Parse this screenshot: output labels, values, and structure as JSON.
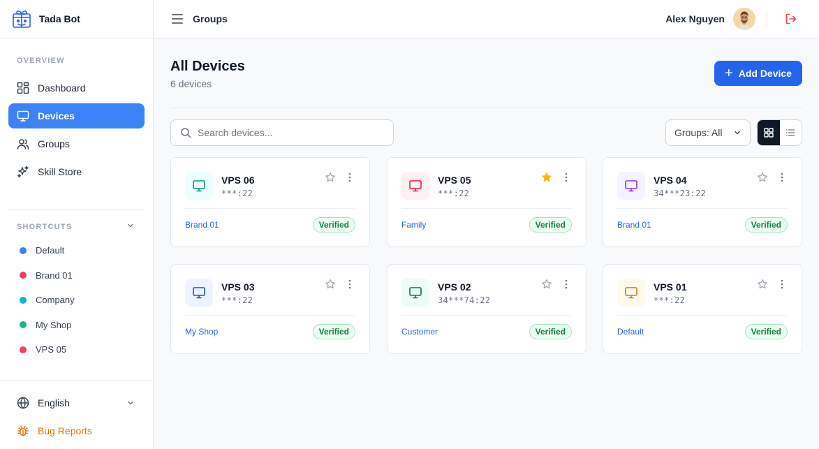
{
  "app": {
    "name": "Tada Bot"
  },
  "sidebar": {
    "overview_label": "OVERVIEW",
    "nav": [
      {
        "label": "Dashboard",
        "icon": "dashboard-icon",
        "active": false
      },
      {
        "label": "Devices",
        "icon": "monitor-icon",
        "active": true
      },
      {
        "label": "Groups",
        "icon": "users-icon",
        "active": false
      },
      {
        "label": "Skill Store",
        "icon": "sparkles-icon",
        "active": false
      }
    ],
    "shortcuts_label": "SHORTCUTS",
    "shortcuts": [
      {
        "label": "Default",
        "color": "#3b82f6"
      },
      {
        "label": "Brand 01",
        "color": "#f43f5e"
      },
      {
        "label": "Company",
        "color": "#06b6d4"
      },
      {
        "label": "My Shop",
        "color": "#10b981"
      },
      {
        "label": "VPS 05",
        "color": "#f43f5e"
      }
    ],
    "language": "English",
    "bug_reports": "Bug Reports"
  },
  "topbar": {
    "breadcrumb": "Groups",
    "user_name": "Alex Nguyen"
  },
  "main": {
    "title": "All Devices",
    "subtitle": "6 devices",
    "add_button": "Add Device",
    "search_placeholder": "Search devices...",
    "group_filter": "Groups: All"
  },
  "devices": [
    {
      "name": "VPS 06",
      "address": "***:22",
      "group": "Brand 01",
      "status": "Verified",
      "starred": false,
      "color": "#0d9488",
      "bg": "#ecfeff"
    },
    {
      "name": "VPS 05",
      "address": "***:22",
      "group": "Family",
      "status": "Verified",
      "starred": true,
      "color": "#e11d48",
      "bg": "#fff1f2"
    },
    {
      "name": "VPS 04",
      "address": "34***23:22",
      "group": "Brand 01",
      "status": "Verified",
      "starred": false,
      "color": "#9333ea",
      "bg": "#f5f3ff"
    },
    {
      "name": "VPS 03",
      "address": "***:22",
      "group": "My Shop",
      "status": "Verified",
      "starred": false,
      "color": "#1d4ed8",
      "bg": "#eef4ff"
    },
    {
      "name": "VPS 02",
      "address": "34***74:22",
      "group": "Customer",
      "status": "Verified",
      "starred": false,
      "color": "#047857",
      "bg": "#ecfdf5"
    },
    {
      "name": "VPS 01",
      "address": "***:22",
      "group": "Default",
      "status": "Verified",
      "starred": false,
      "color": "#d97706",
      "bg": "#fffbeb"
    }
  ],
  "colors": {
    "accent": "#3b82f6",
    "primary_button": "#2563eb",
    "star_filled": "#f5b800",
    "danger": "#ef4444",
    "bug": "#d97706"
  }
}
